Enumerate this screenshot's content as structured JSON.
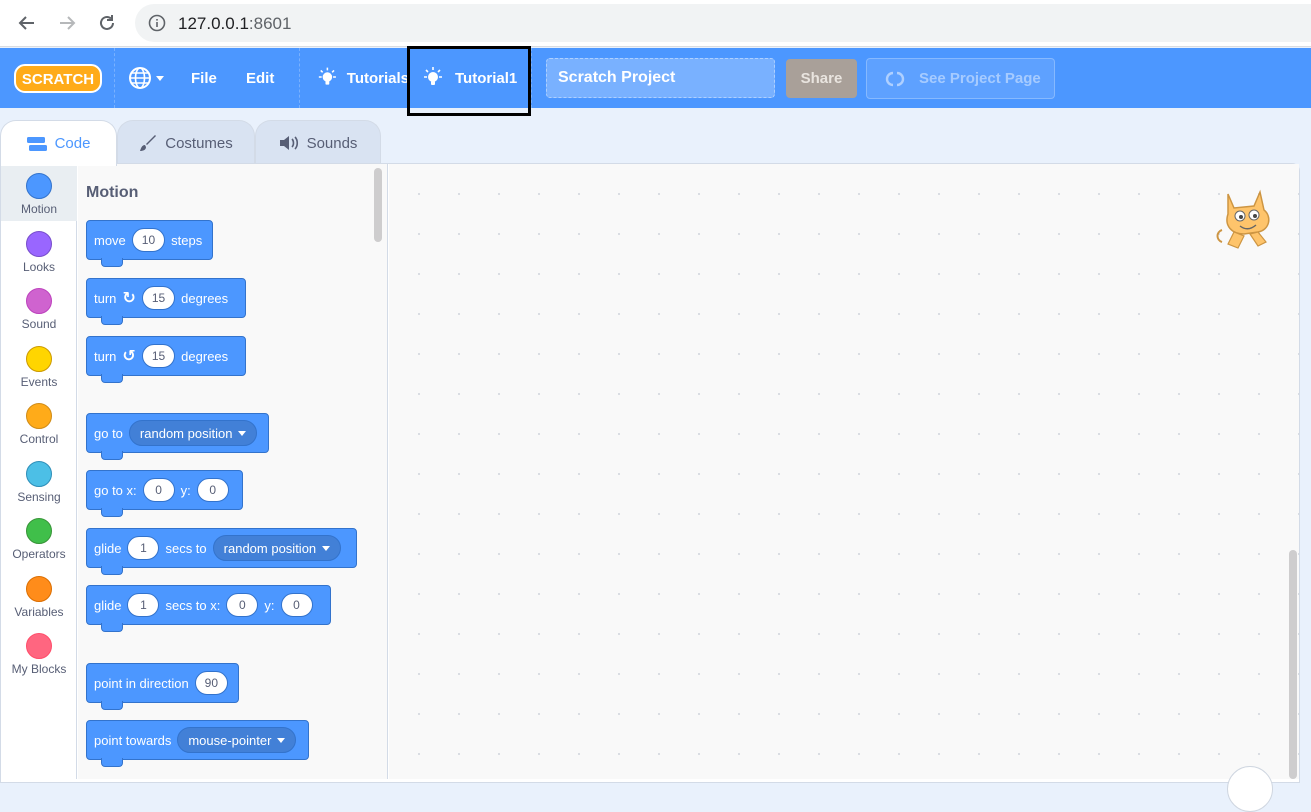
{
  "browser": {
    "url_host": "127.0.0.1",
    "url_port": ":8601"
  },
  "menubar": {
    "logo_text": "SCRATCH",
    "file": "File",
    "edit": "Edit",
    "tutorials": "Tutorials",
    "tutorial1": "Tutorial1",
    "project_title": "Scratch Project",
    "share": "Share",
    "see_project_page": "See Project Page"
  },
  "tabs": {
    "code": "Code",
    "costumes": "Costumes",
    "sounds": "Sounds"
  },
  "categories": [
    {
      "label": "Motion",
      "color": "#4c97ff"
    },
    {
      "label": "Looks",
      "color": "#9966ff"
    },
    {
      "label": "Sound",
      "color": "#cf63cf"
    },
    {
      "label": "Events",
      "color": "#ffd500"
    },
    {
      "label": "Control",
      "color": "#ffab19"
    },
    {
      "label": "Sensing",
      "color": "#4cbfe6"
    },
    {
      "label": "Operators",
      "color": "#40bf4a"
    },
    {
      "label": "Variables",
      "color": "#ff8c1a"
    },
    {
      "label": "My Blocks",
      "color": "#ff6680"
    }
  ],
  "palette": {
    "section_title": "Motion",
    "blocks": {
      "move": {
        "t1": "move",
        "v1": "10",
        "t2": "steps"
      },
      "turn_right": {
        "t1": "turn",
        "v1": "15",
        "t2": "degrees"
      },
      "turn_left": {
        "t1": "turn",
        "v1": "15",
        "t2": "degrees"
      },
      "goto": {
        "t1": "go to",
        "d1": "random position"
      },
      "goto_xy": {
        "t1": "go to x:",
        "v1": "0",
        "t2": "y:",
        "v2": "0"
      },
      "glide_to": {
        "t1": "glide",
        "v1": "1",
        "t2": "secs to",
        "d1": "random position"
      },
      "glide_xy": {
        "t1": "glide",
        "v1": "1",
        "t2": "secs to x:",
        "v2": "0",
        "t3": "y:",
        "v3": "0"
      },
      "point_dir": {
        "t1": "point in direction",
        "v1": "90"
      },
      "point_towards": {
        "t1": "point towards",
        "d1": "mouse-pointer"
      }
    }
  }
}
